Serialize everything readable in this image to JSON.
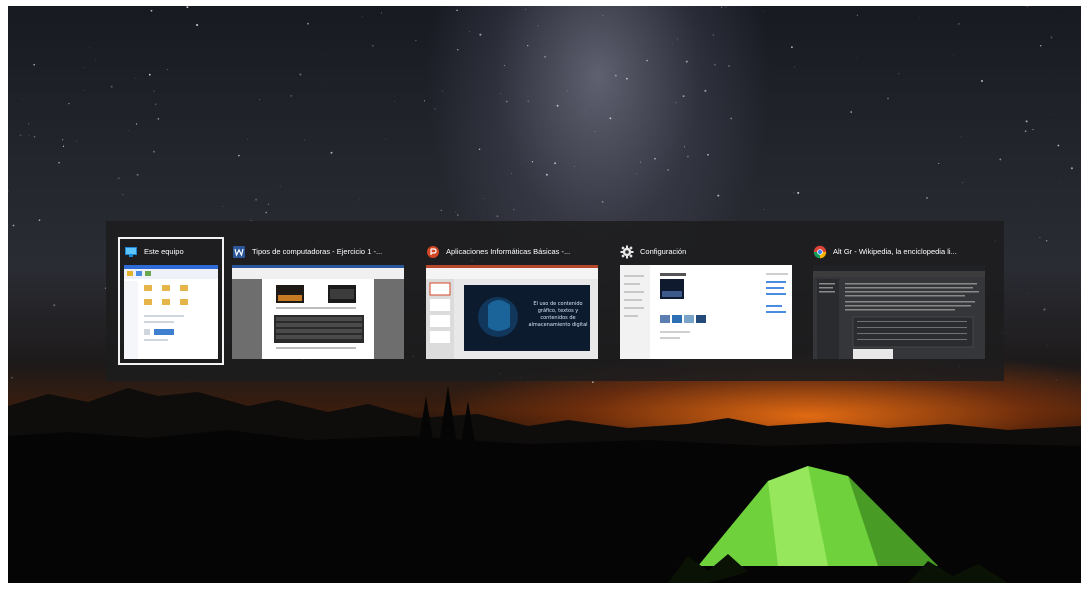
{
  "task_switcher": {
    "windows": [
      {
        "title": "Este equipo",
        "icon": "this-pc-icon",
        "selected": true
      },
      {
        "title": "Tipos de computadoras - Ejercicio 1 -...",
        "icon": "word-icon",
        "selected": false
      },
      {
        "title": "Aplicaciones Informáticas Básicas -...",
        "icon": "powerpoint-icon",
        "selected": false
      },
      {
        "title": "Configuración",
        "icon": "gear-icon",
        "selected": false
      },
      {
        "title": "Alt Gr - Wikipedia, la enciclopedia li...",
        "icon": "chrome-icon",
        "selected": false
      }
    ]
  },
  "slide_thumbnail": {
    "text": "El uso de contenido gráfico, textos y contenidos de almacenamiento digital"
  },
  "colors": {
    "word": "#2b579a",
    "powerpoint": "#d24726",
    "chrome_red": "#db4437",
    "chrome_yellow": "#f4b400",
    "chrome_green": "#0f9d58",
    "chrome_blue": "#4285f4",
    "tent_green": "#7ee04a",
    "horizon_orange": "#ff7a1a"
  }
}
